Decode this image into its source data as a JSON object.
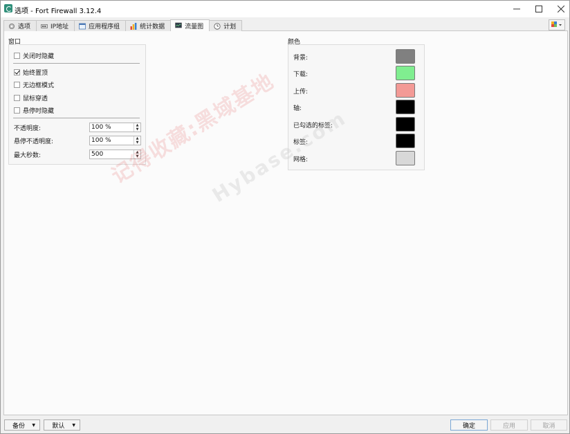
{
  "window": {
    "title": "选项 - Fort Firewall 3.12.4"
  },
  "tabs": [
    {
      "label": "选项",
      "icon": "gear-icon"
    },
    {
      "label": "IP地址",
      "icon": "network-card-icon"
    },
    {
      "label": "应用程序组",
      "icon": "app-window-icon"
    },
    {
      "label": "统计数据",
      "icon": "bar-chart-icon"
    },
    {
      "label": "流量图",
      "icon": "graph-monitor-icon",
      "active": true
    },
    {
      "label": "计划",
      "icon": "clock-icon"
    }
  ],
  "window_group": {
    "title": "窗口",
    "checkboxes": [
      {
        "label": "关闭时隐藏",
        "checked": false
      },
      {
        "label": "始终置顶",
        "checked": true
      },
      {
        "label": "无边框模式",
        "checked": false
      },
      {
        "label": "鼠标穿透",
        "checked": false
      },
      {
        "label": "悬停时隐藏",
        "checked": false
      }
    ],
    "fields": [
      {
        "label": "不透明度:",
        "value": "100 %"
      },
      {
        "label": "悬停不透明度:",
        "value": "100 %"
      },
      {
        "label": "最大秒数:",
        "value": "500"
      }
    ]
  },
  "colors_group": {
    "title": "颜色",
    "items": [
      {
        "label": "背景:",
        "color": "#808080"
      },
      {
        "label": "下载:",
        "color": "#80ee90"
      },
      {
        "label": "上传:",
        "color": "#f39a96"
      },
      {
        "label": "轴:",
        "color": "#000000"
      },
      {
        "label": "已勾选的标签:",
        "color": "#000000"
      },
      {
        "label": "标签:",
        "color": "#000000"
      },
      {
        "label": "网格:",
        "color": "#d8d8d8"
      }
    ]
  },
  "watermark": {
    "text_cn": "记得收藏:黑域基地",
    "text_en": "Hybase.com"
  },
  "bottom": {
    "backup": "备份",
    "defaults": "默认",
    "ok": "确定",
    "apply": "应用",
    "cancel": "取消"
  }
}
